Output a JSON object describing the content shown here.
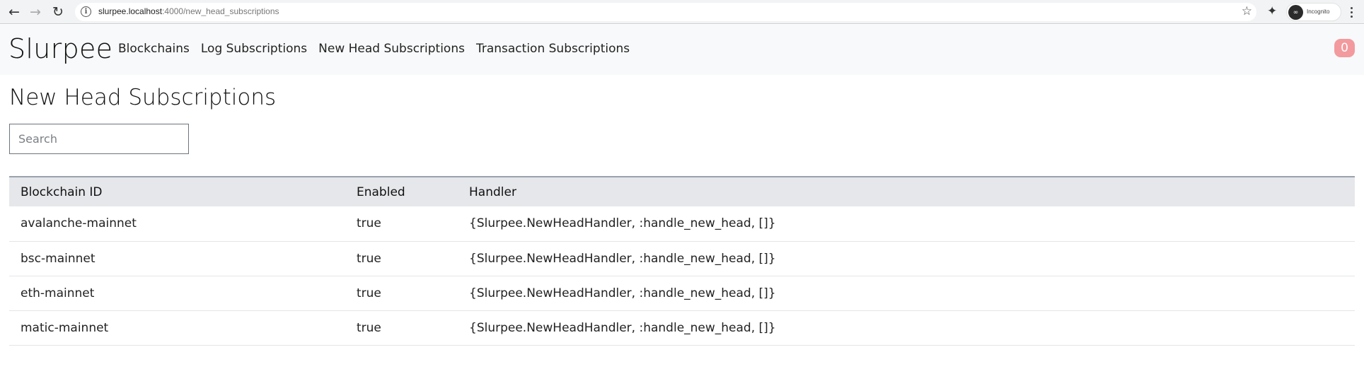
{
  "browser": {
    "url_host": "slurpee.localhost",
    "url_rest": ":4000/new_head_subscriptions",
    "profile_label": "Incognito",
    "icons": {
      "back": "arrow-left-icon",
      "forward": "arrow-right-icon",
      "reload": "reload-icon",
      "site_info": "info-icon",
      "bookmark": "star-icon",
      "extensions": "puzzle-icon",
      "incognito": "incognito-icon",
      "menu": "kebab-menu-icon"
    }
  },
  "header": {
    "brand": "Slurpee",
    "nav": [
      {
        "label": "Blockchains"
      },
      {
        "label": "Log Subscriptions"
      },
      {
        "label": "New Head Subscriptions"
      },
      {
        "label": "Transaction Subscriptions"
      }
    ],
    "badge_count": "0",
    "badge_color": "#f29a9e"
  },
  "main": {
    "title": "New Head Subscriptions",
    "search": {
      "placeholder": "Search",
      "value": ""
    },
    "table": {
      "columns": [
        "Blockchain ID",
        "Enabled",
        "Handler"
      ],
      "rows": [
        {
          "blockchain_id": "avalanche-mainnet",
          "enabled": "true",
          "handler": "{Slurpee.NewHeadHandler, :handle_new_head, []}"
        },
        {
          "blockchain_id": "bsc-mainnet",
          "enabled": "true",
          "handler": "{Slurpee.NewHeadHandler, :handle_new_head, []}"
        },
        {
          "blockchain_id": "eth-mainnet",
          "enabled": "true",
          "handler": "{Slurpee.NewHeadHandler, :handle_new_head, []}"
        },
        {
          "blockchain_id": "matic-mainnet",
          "enabled": "true",
          "handler": "{Slurpee.NewHeadHandler, :handle_new_head, []}"
        }
      ]
    }
  }
}
